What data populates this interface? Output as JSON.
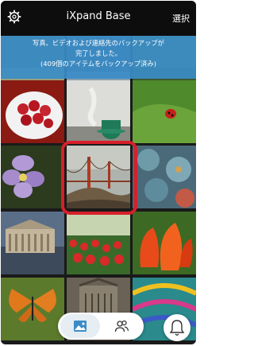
{
  "app": {
    "title": "iXpand Base",
    "select_label": "選択"
  },
  "banner": {
    "line1": "写真、ビデオおよび連絡先のバックアップが",
    "line2": "完了しました。",
    "line3": "(409個のアイテムをバックアップ済み)"
  },
  "icons": {
    "settings": "gear-icon",
    "photos_tab": "photo-icon",
    "contacts_tab": "people-icon",
    "notifications": "bell-icon"
  },
  "colors": {
    "navbar": "#0d0d0d",
    "banner": "#3a8cc7",
    "highlight": "#d6202a",
    "tab_icon": "#3a8cc7"
  }
}
